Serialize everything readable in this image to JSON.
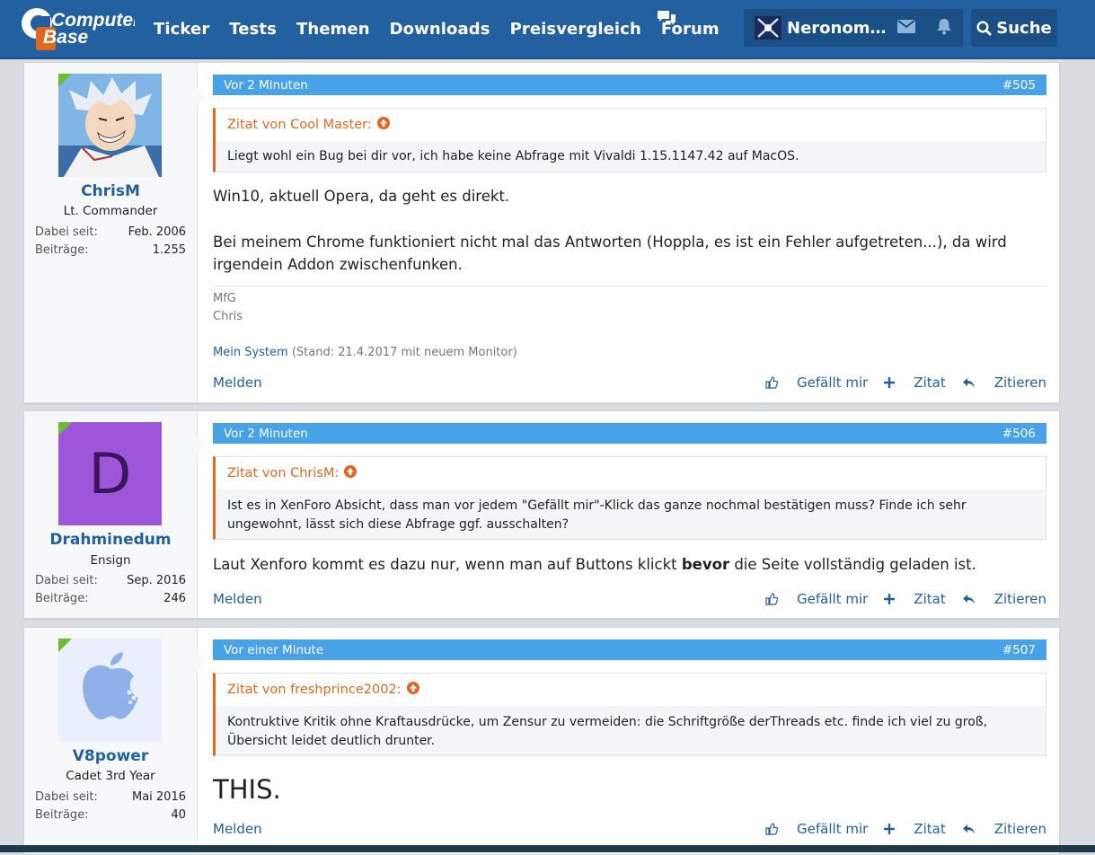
{
  "header": {
    "logo_top": "Computer",
    "logo_bottom": "Base",
    "nav": [
      "Ticker",
      "Tests",
      "Themen",
      "Downloads",
      "Preisvergleich",
      "Forum"
    ],
    "username": "Neronomic...",
    "search_label": "Suche"
  },
  "colors": {
    "brand": "#22609f",
    "post_header": "#48a2e8",
    "quote_accent": "#e1671f",
    "online": "#6dbd33"
  },
  "posts": [
    {
      "time": "Vor 2 Minuten",
      "number": "#505",
      "user": {
        "name": "ChrisM",
        "title": "Lt. Commander",
        "joined_label": "Dabei seit:",
        "joined": "Feb. 2006",
        "posts_label": "Beiträge:",
        "posts": "1.255"
      },
      "quote": {
        "author": "Zitat von Cool Master:",
        "text": "Liegt wohl ein Bug bei dir vor, ich habe keine Abfrage mit Vivaldi 1.15.1147.42 auf MacOS."
      },
      "body": [
        "Win10, aktuell Opera, da geht es direkt.",
        "Bei meinem Chrome funktioniert nicht mal das Antworten (Hoppla, es ist ein Fehler aufgetreten...), da wird irgendein Addon zwischenfunken."
      ],
      "signature": {
        "line1": "MfG",
        "line2": "Chris",
        "link": "Mein System",
        "note": "(Stand: 21.4.2017 mit neuem Monitor)"
      },
      "actions": {
        "report": "Melden",
        "like": "Gefällt mir",
        "quote": "Zitat",
        "reply": "Zitieren"
      }
    },
    {
      "time": "Vor 2 Minuten",
      "number": "#506",
      "user": {
        "name": "Drahminedum",
        "title": "Ensign",
        "avatar_letter": "D",
        "joined_label": "Dabei seit:",
        "joined": "Sep. 2016",
        "posts_label": "Beiträge:",
        "posts": "246"
      },
      "quote": {
        "author": "Zitat von ChrisM:",
        "text": "Ist es in XenForo Absicht, dass man vor jedem \"Gefällt mir\"-Klick das ganze nochmal bestätigen muss? Finde ich sehr ungewohnt, lässt sich diese Abfrage ggf. ausschalten?"
      },
      "body_pre": "Laut Xenforo kommt es dazu nur, wenn man auf Buttons klickt ",
      "body_bold": "bevor",
      "body_post": " die Seite vollständig geladen ist.",
      "actions": {
        "report": "Melden",
        "like": "Gefällt mir",
        "quote": "Zitat",
        "reply": "Zitieren"
      }
    },
    {
      "time": "Vor einer Minute",
      "number": "#507",
      "user": {
        "name": "V8power",
        "title": "Cadet 3rd Year",
        "joined_label": "Dabei seit:",
        "joined": "Mai 2016",
        "posts_label": "Beiträge:",
        "posts": "40"
      },
      "quote": {
        "author": "Zitat von freshprince2002:",
        "text": "Kontruktive Kritik ohne Kraftausdrücke, um Zensur zu vermeiden: die Schriftgröße derThreads etc. finde ich viel zu groß, Übersicht leidet deutlich drunter."
      },
      "body": "THIS.",
      "actions": {
        "report": "Melden",
        "like": "Gefällt mir",
        "quote": "Zitat",
        "reply": "Zitieren"
      }
    }
  ]
}
